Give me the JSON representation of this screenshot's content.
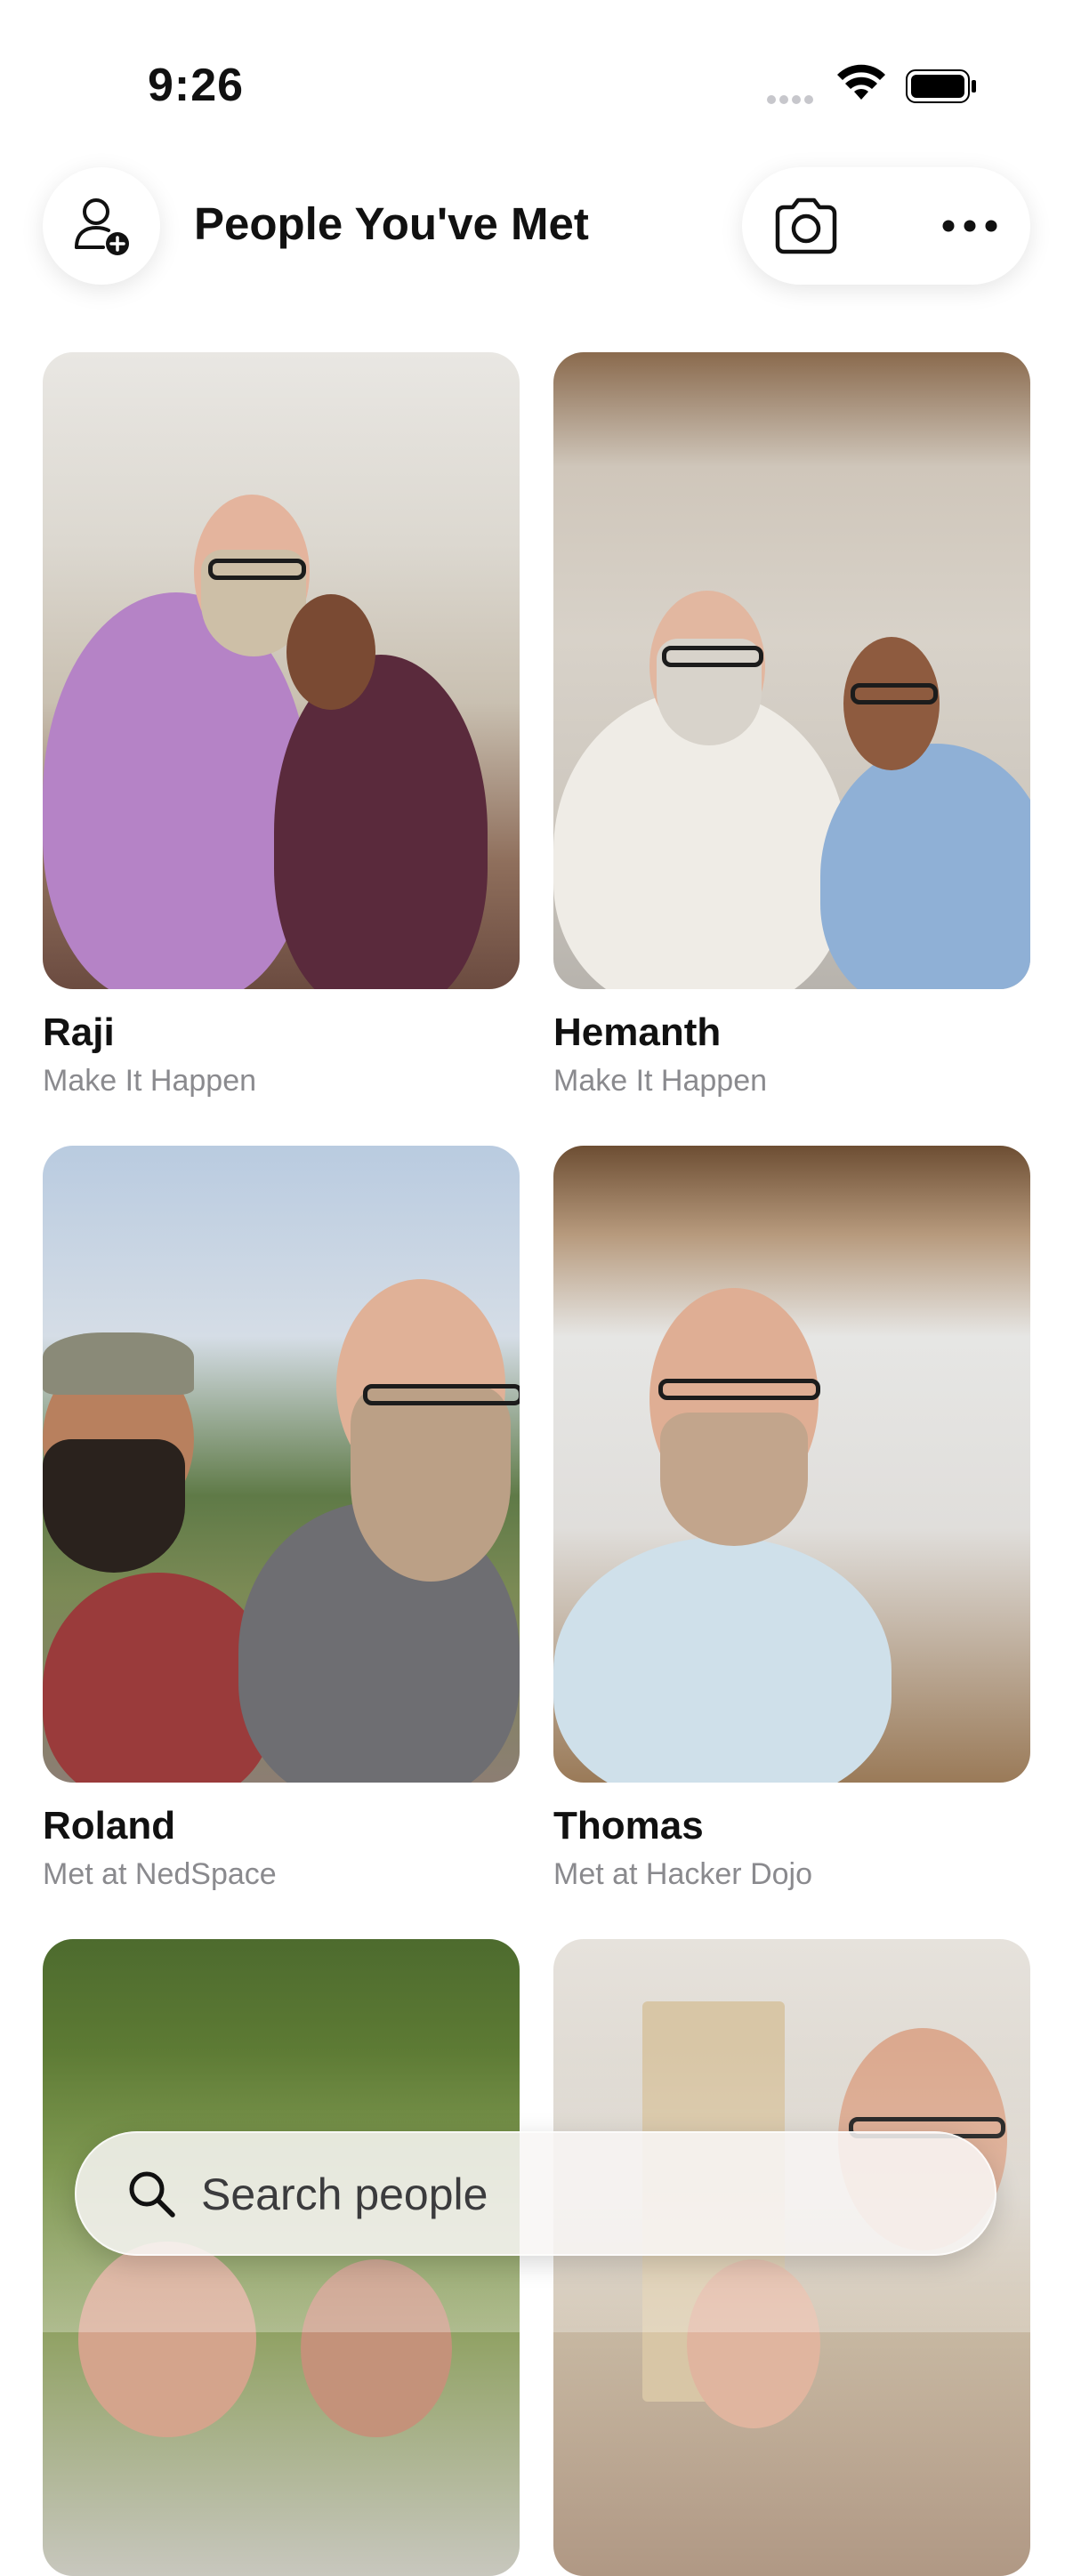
{
  "status_bar": {
    "time": "9:26",
    "icons": [
      "signal-icon",
      "wifi-icon",
      "battery-icon"
    ]
  },
  "header": {
    "title": "People You've Met",
    "add_icon": "add-person-icon",
    "camera_icon": "camera-icon",
    "more_icon": "more-icon"
  },
  "people": [
    {
      "name": "Raji",
      "subtitle": "Make It Happen"
    },
    {
      "name": "Hemanth",
      "subtitle": "Make It Happen"
    },
    {
      "name": "Roland",
      "subtitle": "Met at NedSpace"
    },
    {
      "name": "Thomas",
      "subtitle": "Met at Hacker Dojo"
    },
    {
      "name": "",
      "subtitle": ""
    },
    {
      "name": "",
      "subtitle": ""
    }
  ],
  "search": {
    "placeholder": "Search people",
    "icon": "search-icon"
  },
  "colors": {
    "background": "#ffffff",
    "text": "#111111",
    "secondary_text": "#8a8a8e"
  }
}
